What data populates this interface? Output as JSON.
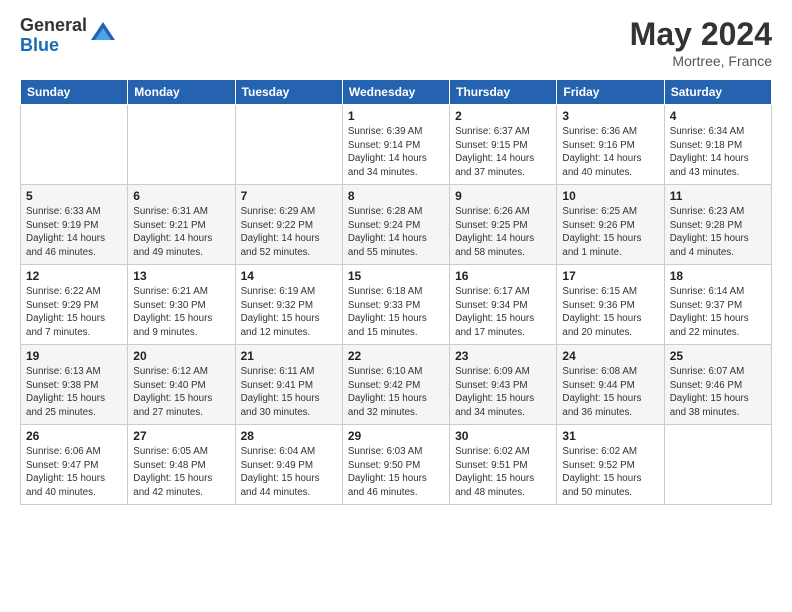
{
  "logo": {
    "general": "General",
    "blue": "Blue"
  },
  "title": {
    "month": "May 2024",
    "location": "Mortree, France"
  },
  "weekdays": [
    "Sunday",
    "Monday",
    "Tuesday",
    "Wednesday",
    "Thursday",
    "Friday",
    "Saturday"
  ],
  "weeks": [
    [
      {
        "day": "",
        "sunrise": "",
        "sunset": "",
        "daylight": ""
      },
      {
        "day": "",
        "sunrise": "",
        "sunset": "",
        "daylight": ""
      },
      {
        "day": "",
        "sunrise": "",
        "sunset": "",
        "daylight": ""
      },
      {
        "day": "1",
        "sunrise": "Sunrise: 6:39 AM",
        "sunset": "Sunset: 9:14 PM",
        "daylight": "Daylight: 14 hours and 34 minutes."
      },
      {
        "day": "2",
        "sunrise": "Sunrise: 6:37 AM",
        "sunset": "Sunset: 9:15 PM",
        "daylight": "Daylight: 14 hours and 37 minutes."
      },
      {
        "day": "3",
        "sunrise": "Sunrise: 6:36 AM",
        "sunset": "Sunset: 9:16 PM",
        "daylight": "Daylight: 14 hours and 40 minutes."
      },
      {
        "day": "4",
        "sunrise": "Sunrise: 6:34 AM",
        "sunset": "Sunset: 9:18 PM",
        "daylight": "Daylight: 14 hours and 43 minutes."
      }
    ],
    [
      {
        "day": "5",
        "sunrise": "Sunrise: 6:33 AM",
        "sunset": "Sunset: 9:19 PM",
        "daylight": "Daylight: 14 hours and 46 minutes."
      },
      {
        "day": "6",
        "sunrise": "Sunrise: 6:31 AM",
        "sunset": "Sunset: 9:21 PM",
        "daylight": "Daylight: 14 hours and 49 minutes."
      },
      {
        "day": "7",
        "sunrise": "Sunrise: 6:29 AM",
        "sunset": "Sunset: 9:22 PM",
        "daylight": "Daylight: 14 hours and 52 minutes."
      },
      {
        "day": "8",
        "sunrise": "Sunrise: 6:28 AM",
        "sunset": "Sunset: 9:24 PM",
        "daylight": "Daylight: 14 hours and 55 minutes."
      },
      {
        "day": "9",
        "sunrise": "Sunrise: 6:26 AM",
        "sunset": "Sunset: 9:25 PM",
        "daylight": "Daylight: 14 hours and 58 minutes."
      },
      {
        "day": "10",
        "sunrise": "Sunrise: 6:25 AM",
        "sunset": "Sunset: 9:26 PM",
        "daylight": "Daylight: 15 hours and 1 minute."
      },
      {
        "day": "11",
        "sunrise": "Sunrise: 6:23 AM",
        "sunset": "Sunset: 9:28 PM",
        "daylight": "Daylight: 15 hours and 4 minutes."
      }
    ],
    [
      {
        "day": "12",
        "sunrise": "Sunrise: 6:22 AM",
        "sunset": "Sunset: 9:29 PM",
        "daylight": "Daylight: 15 hours and 7 minutes."
      },
      {
        "day": "13",
        "sunrise": "Sunrise: 6:21 AM",
        "sunset": "Sunset: 9:30 PM",
        "daylight": "Daylight: 15 hours and 9 minutes."
      },
      {
        "day": "14",
        "sunrise": "Sunrise: 6:19 AM",
        "sunset": "Sunset: 9:32 PM",
        "daylight": "Daylight: 15 hours and 12 minutes."
      },
      {
        "day": "15",
        "sunrise": "Sunrise: 6:18 AM",
        "sunset": "Sunset: 9:33 PM",
        "daylight": "Daylight: 15 hours and 15 minutes."
      },
      {
        "day": "16",
        "sunrise": "Sunrise: 6:17 AM",
        "sunset": "Sunset: 9:34 PM",
        "daylight": "Daylight: 15 hours and 17 minutes."
      },
      {
        "day": "17",
        "sunrise": "Sunrise: 6:15 AM",
        "sunset": "Sunset: 9:36 PM",
        "daylight": "Daylight: 15 hours and 20 minutes."
      },
      {
        "day": "18",
        "sunrise": "Sunrise: 6:14 AM",
        "sunset": "Sunset: 9:37 PM",
        "daylight": "Daylight: 15 hours and 22 minutes."
      }
    ],
    [
      {
        "day": "19",
        "sunrise": "Sunrise: 6:13 AM",
        "sunset": "Sunset: 9:38 PM",
        "daylight": "Daylight: 15 hours and 25 minutes."
      },
      {
        "day": "20",
        "sunrise": "Sunrise: 6:12 AM",
        "sunset": "Sunset: 9:40 PM",
        "daylight": "Daylight: 15 hours and 27 minutes."
      },
      {
        "day": "21",
        "sunrise": "Sunrise: 6:11 AM",
        "sunset": "Sunset: 9:41 PM",
        "daylight": "Daylight: 15 hours and 30 minutes."
      },
      {
        "day": "22",
        "sunrise": "Sunrise: 6:10 AM",
        "sunset": "Sunset: 9:42 PM",
        "daylight": "Daylight: 15 hours and 32 minutes."
      },
      {
        "day": "23",
        "sunrise": "Sunrise: 6:09 AM",
        "sunset": "Sunset: 9:43 PM",
        "daylight": "Daylight: 15 hours and 34 minutes."
      },
      {
        "day": "24",
        "sunrise": "Sunrise: 6:08 AM",
        "sunset": "Sunset: 9:44 PM",
        "daylight": "Daylight: 15 hours and 36 minutes."
      },
      {
        "day": "25",
        "sunrise": "Sunrise: 6:07 AM",
        "sunset": "Sunset: 9:46 PM",
        "daylight": "Daylight: 15 hours and 38 minutes."
      }
    ],
    [
      {
        "day": "26",
        "sunrise": "Sunrise: 6:06 AM",
        "sunset": "Sunset: 9:47 PM",
        "daylight": "Daylight: 15 hours and 40 minutes."
      },
      {
        "day": "27",
        "sunrise": "Sunrise: 6:05 AM",
        "sunset": "Sunset: 9:48 PM",
        "daylight": "Daylight: 15 hours and 42 minutes."
      },
      {
        "day": "28",
        "sunrise": "Sunrise: 6:04 AM",
        "sunset": "Sunset: 9:49 PM",
        "daylight": "Daylight: 15 hours and 44 minutes."
      },
      {
        "day": "29",
        "sunrise": "Sunrise: 6:03 AM",
        "sunset": "Sunset: 9:50 PM",
        "daylight": "Daylight: 15 hours and 46 minutes."
      },
      {
        "day": "30",
        "sunrise": "Sunrise: 6:02 AM",
        "sunset": "Sunset: 9:51 PM",
        "daylight": "Daylight: 15 hours and 48 minutes."
      },
      {
        "day": "31",
        "sunrise": "Sunrise: 6:02 AM",
        "sunset": "Sunset: 9:52 PM",
        "daylight": "Daylight: 15 hours and 50 minutes."
      },
      {
        "day": "",
        "sunrise": "",
        "sunset": "",
        "daylight": ""
      }
    ]
  ]
}
